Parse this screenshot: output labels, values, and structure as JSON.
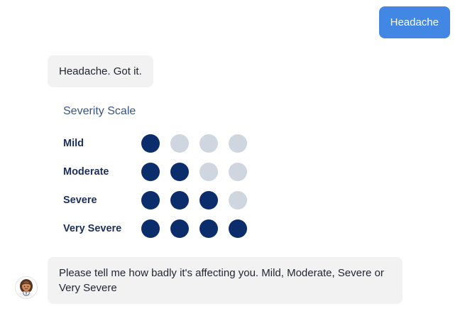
{
  "messages": {
    "user_message": "Headache",
    "bot_ack": "Headache. Got it.",
    "bot_question": "Please tell me how badly it's affecting you. Mild, Moderate, Severe or Very Severe"
  },
  "severity_scale": {
    "title": "Severity Scale",
    "max_level": 4,
    "levels": [
      {
        "label": "Mild",
        "filled": 1
      },
      {
        "label": "Moderate",
        "filled": 2
      },
      {
        "label": "Severe",
        "filled": 3
      },
      {
        "label": "Very Severe",
        "filled": 4
      }
    ]
  },
  "colors": {
    "user_bubble": "#4287e3",
    "bot_bubble": "#f2f2f3",
    "dot_filled": "#0c2d6b",
    "dot_empty": "#d0d6df",
    "scale_title": "#3a5582"
  },
  "icons": {
    "avatar": "female-doctor-avatar-icon"
  }
}
